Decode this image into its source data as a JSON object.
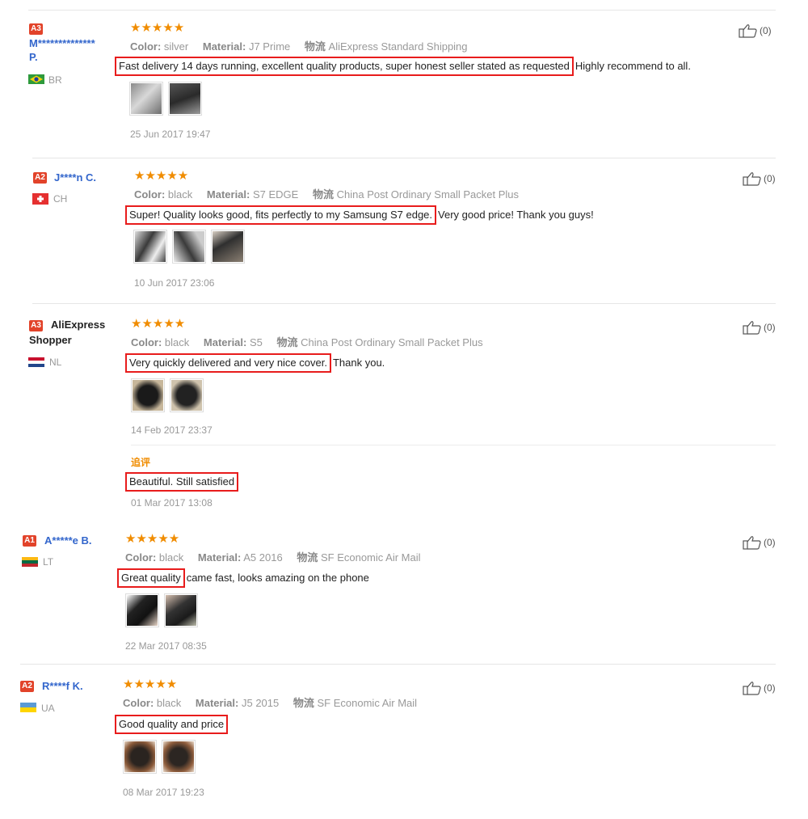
{
  "reviews": [
    {
      "badge": "A3",
      "name_line1": "M**************",
      "name_line2": "P.",
      "country": "BR",
      "stars": "★★★★★",
      "color_label": "Color:",
      "color_value": "silver",
      "material_label": "Material:",
      "material_value": "J7 Prime",
      "shipping_label": "物流",
      "shipping_value": "AliExpress Standard Shipping",
      "highlight": "Fast delivery 14 days running, excellent quality products, super honest seller stated as requested",
      "rest": "Highly recommend to all.",
      "date": "25 Jun 2017 19:47",
      "likes": "(0)"
    },
    {
      "badge": "A2",
      "name_line1": "J****n C.",
      "country": "CH",
      "stars": "★★★★★",
      "color_label": "Color:",
      "color_value": "black",
      "material_label": "Material:",
      "material_value": "S7 EDGE",
      "shipping_label": "物流",
      "shipping_value": "China Post Ordinary Small Packet Plus",
      "highlight": "Super! Quality looks good, fits perfectly to my Samsung S7 edge.",
      "rest": "Very good price! Thank you guys!",
      "date": "10 Jun 2017 23:06",
      "likes": "(0)"
    },
    {
      "badge": "A3",
      "name_line1": "AliExpress",
      "name_line2": "Shopper",
      "country": "NL",
      "stars": "★★★★★",
      "color_label": "Color:",
      "color_value": "black",
      "material_label": "Material:",
      "material_value": "S5",
      "shipping_label": "物流",
      "shipping_value": "China Post Ordinary Small Packet Plus",
      "highlight": "Very quickly delivered and very nice cover.",
      "rest": "Thank you.",
      "date": "14 Feb 2017 23:37",
      "likes": "(0)",
      "additional_label": "追评",
      "additional_text": "Beautiful. Still satisfied",
      "additional_date": "01 Mar 2017 13:08"
    },
    {
      "badge": "A1",
      "name_line1": "A*****e B.",
      "country": "LT",
      "stars": "★★★★★",
      "color_label": "Color:",
      "color_value": "black",
      "material_label": "Material:",
      "material_value": "A5 2016",
      "shipping_label": "物流",
      "shipping_value": "SF Economic Air Mail",
      "highlight": "Great quality",
      "rest": "came fast, looks amazing on the phone",
      "date": "22 Mar 2017 08:35",
      "likes": "(0)"
    },
    {
      "badge": "A2",
      "name_line1": "R****f K.",
      "country": "UA",
      "stars": "★★★★★",
      "color_label": "Color:",
      "color_value": "black",
      "material_label": "Material:",
      "material_value": "J5 2015",
      "shipping_label": "物流",
      "shipping_value": "SF Economic Air Mail",
      "highlight": "Good quality and price",
      "rest": "",
      "date": "08 Mar 2017 19:23",
      "likes": "(0)"
    }
  ],
  "colors": {
    "accent_red": "#e81c1c",
    "badge_red": "#e2432a",
    "star_orange": "#f08c00",
    "name_blue": "#3366cc"
  },
  "icons": {
    "like": "thumbs-up-icon"
  }
}
